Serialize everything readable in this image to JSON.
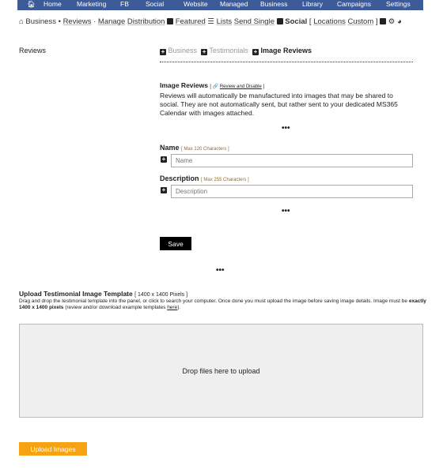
{
  "topnav": {
    "items": [
      "Home",
      "Marketing",
      "FB",
      "Social",
      "Website",
      "Managed",
      "Business",
      "Library",
      "Campaigns",
      "Settings"
    ]
  },
  "subnav": {
    "business": "Business",
    "reviews": "Reviews",
    "manage": "Manage",
    "distribution": "Distribution",
    "featured": "Featured",
    "lists": "Lists",
    "send_single": "Send Single",
    "social": "Social",
    "locations": "Locations",
    "custom": "Custom"
  },
  "sidebar_label": "Reviews",
  "tabs": [
    "Business",
    "Testimonials",
    "Image Reviews"
  ],
  "image_reviews": {
    "title": "Image Reviews",
    "link": "Review and Disable",
    "body": "Reviews will automatically be manufactured into images that may be shared to social. They are not automatically sent, but rather sent to your dedicated MS365 Calendar with images attached."
  },
  "name_field": {
    "label": "Name",
    "hint": "[ Max 120 Characters ]",
    "placeholder": "Name"
  },
  "desc_field": {
    "label": "Description",
    "hint": "[ Max 255 Characters ]",
    "placeholder": "Description"
  },
  "save": "Save",
  "ellipsis": "•••",
  "upload": {
    "title": "Upload Testimonial Image Template",
    "hint": "[ 1400 x 1400 Pixels ]",
    "text1": "Drag and drop the testimonial template into the panel, or click to search your computer. Once done you must upload the image before saving image details. Image must be ",
    "bold": "exactly 1400 x 1400 pixels",
    "text2": " (review and/or download example templates ",
    "link": "here",
    "text3": ")."
  },
  "dropzone": "Drop files here to upload",
  "upload_button": "Upload Images",
  "colors": {
    "nav": "#3d5a99",
    "upload_button": "#f6a313"
  }
}
